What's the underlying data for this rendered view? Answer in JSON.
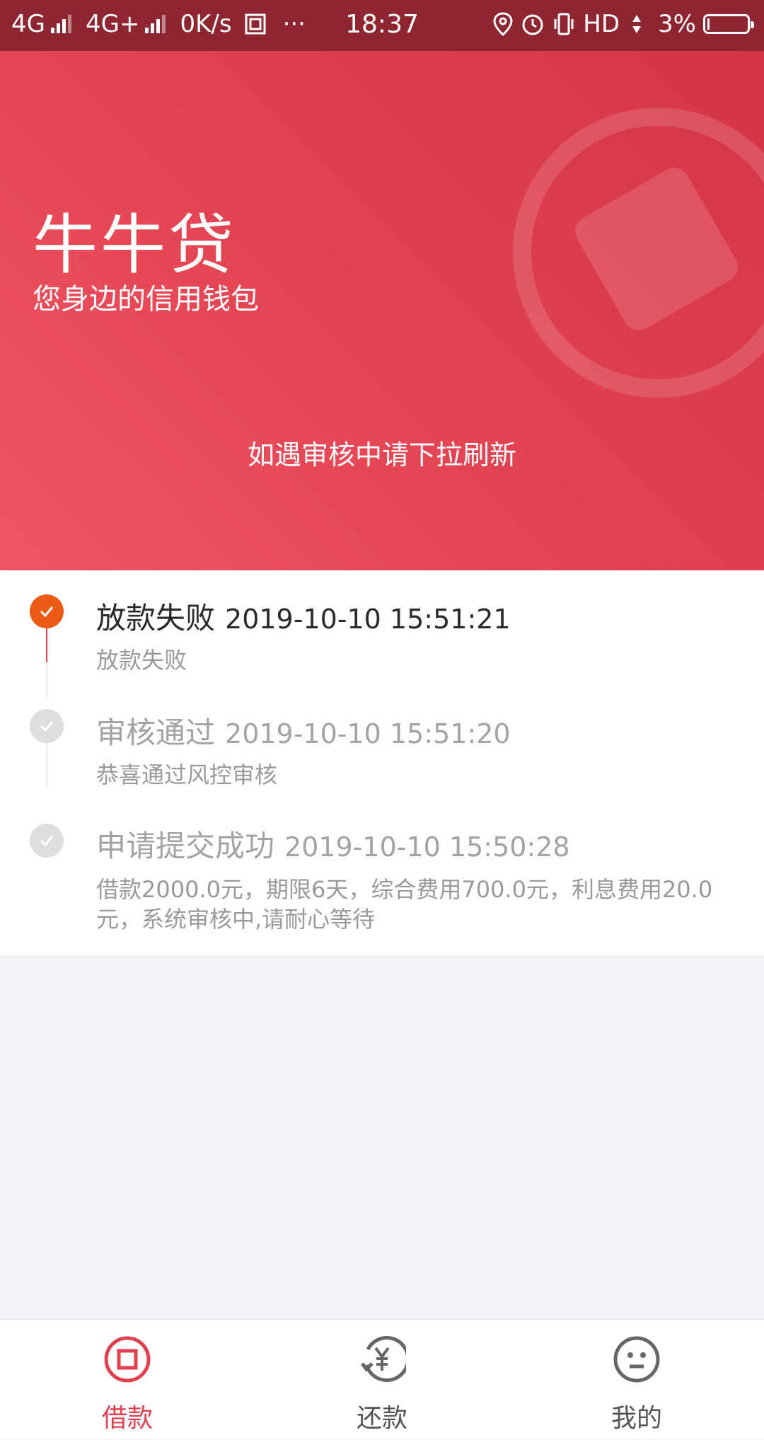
{
  "status_bar": {
    "network1": "4G",
    "network2": "4G+",
    "speed": "0K/s",
    "more": "···",
    "time": "18:37",
    "hd": "HD",
    "battery": "3%"
  },
  "hero": {
    "brand": "牛牛贷",
    "slogan": "您身边的信用钱包",
    "hint": "如遇审核中请下拉刷新"
  },
  "timeline": [
    {
      "title": "放款失败",
      "time": "2019-10-10 15:51:21",
      "desc": "放款失败",
      "state": "active"
    },
    {
      "title": "审核通过",
      "time": "2019-10-10 15:51:20",
      "desc": "恭喜通过风控审核",
      "state": "done"
    },
    {
      "title": "申请提交成功",
      "time": "2019-10-10 15:50:28",
      "desc": "借款2000.0元，期限6天，综合费用700.0元，利息费用20.0元，系统审核中,请耐心等待",
      "state": "done"
    }
  ],
  "tabs": [
    {
      "label": "借款",
      "icon": "loan-icon",
      "active": true
    },
    {
      "label": "还款",
      "icon": "repay-icon",
      "active": false
    },
    {
      "label": "我的",
      "icon": "profile-icon",
      "active": false
    }
  ],
  "colors": {
    "accent": "#e0404f",
    "status_bar": "#8d2631",
    "active_step": "#ec5b16",
    "done_step": "#dedede"
  }
}
